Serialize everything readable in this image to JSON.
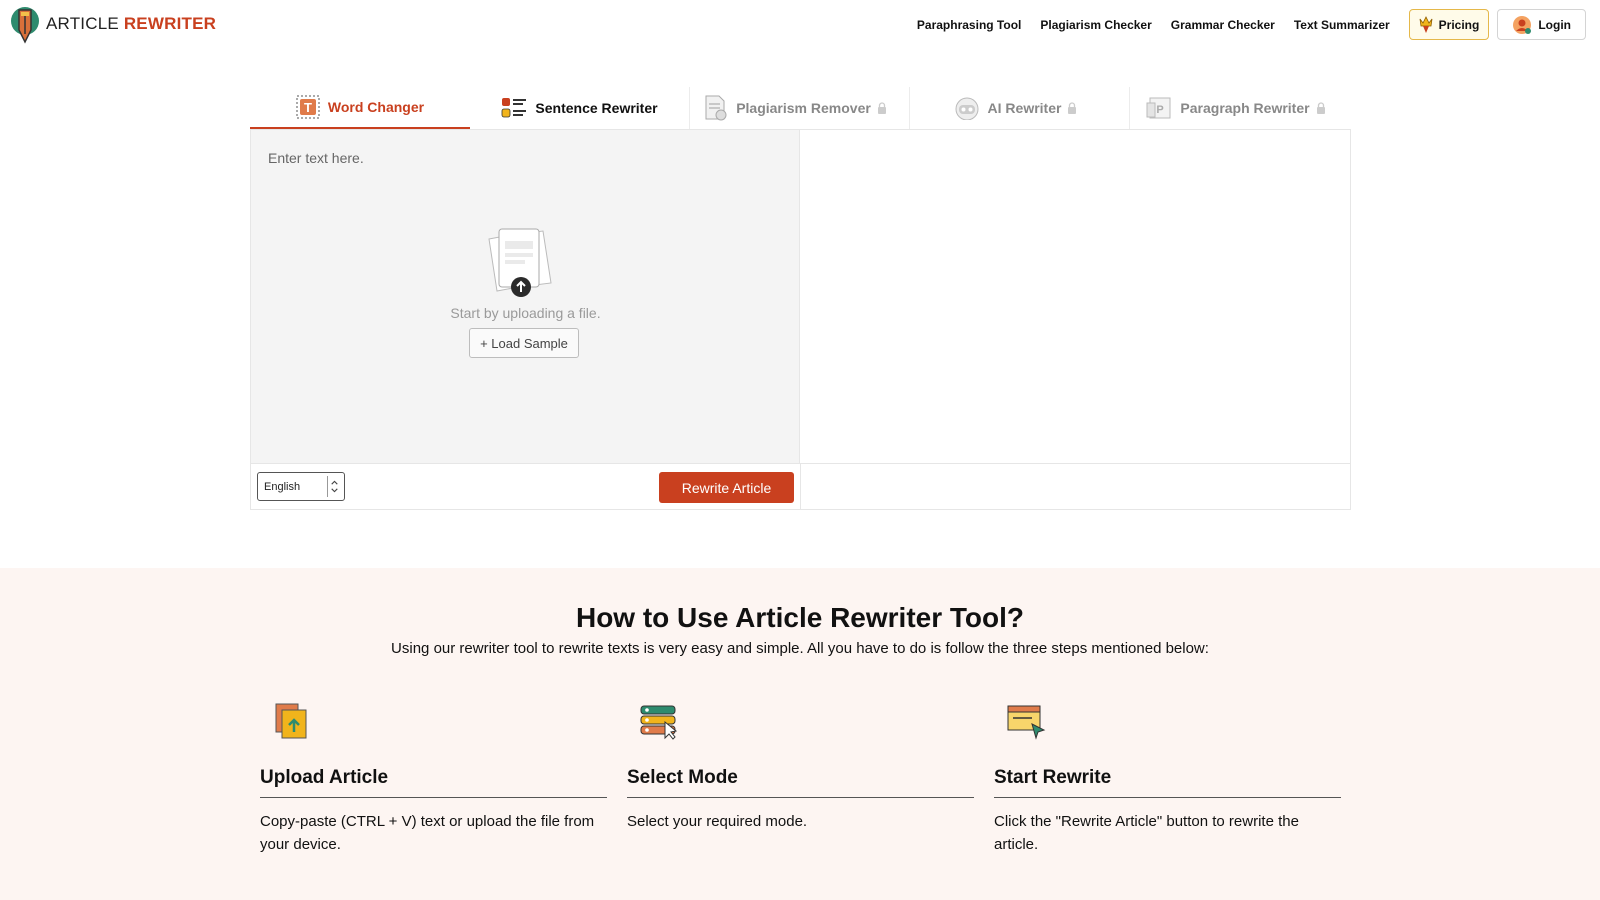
{
  "brand": {
    "prefix": "ARTICLE",
    "accent": "REWRITER",
    "accent_color": "#c9401f",
    "logo_icon": "pen-nib-logo-icon"
  },
  "nav": {
    "links": [
      "Paraphrasing Tool",
      "Plagiarism Checker",
      "Grammar Checker",
      "Text Summarizer"
    ],
    "pricing_label": "Pricing",
    "pricing_icon": "crown-icon",
    "login_label": "Login",
    "login_icon": "user-avatar-icon"
  },
  "tabs": [
    {
      "label": "Word Changer",
      "icon": "word-changer-icon",
      "state": "active",
      "locked": false
    },
    {
      "label": "Sentence Rewriter",
      "icon": "sentence-list-icon",
      "state": "normal",
      "locked": false
    },
    {
      "label": "Plagiarism Remover",
      "icon": "document-check-icon",
      "state": "disabled",
      "locked": true
    },
    {
      "label": "AI Rewriter",
      "icon": "robot-icon",
      "state": "disabled",
      "locked": true
    },
    {
      "label": "Paragraph Rewriter",
      "icon": "paragraph-icon",
      "state": "disabled",
      "locked": true
    }
  ],
  "editor": {
    "placeholder": "Enter text here.",
    "upload_text": "Start by uploading a file.",
    "sample_button": "+ Load Sample",
    "language": "English",
    "rewrite_button": "Rewrite Article"
  },
  "howto": {
    "title": "How to Use Article Rewriter Tool?",
    "subtitle": "Using our rewriter tool to rewrite texts is very easy and simple. All you have to do is follow the three steps mentioned below:",
    "steps": [
      {
        "title": "Upload Article",
        "desc": "Copy-paste (CTRL + V) text or upload the file from your device.",
        "icon": "upload-file-icon"
      },
      {
        "title": "Select Mode",
        "desc": "Select your required mode.",
        "icon": "select-mode-icon"
      },
      {
        "title": "Start Rewrite",
        "desc": "Click the \"Rewrite Article\" button to rewrite the article.",
        "icon": "cursor-window-icon"
      }
    ]
  }
}
